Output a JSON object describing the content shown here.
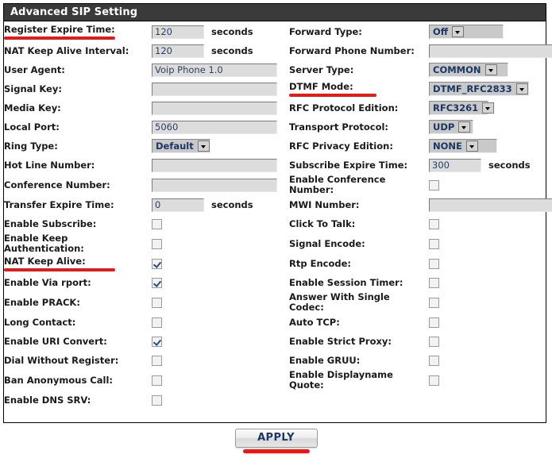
{
  "window": {
    "title": "Advanced SIP Setting"
  },
  "units": {
    "seconds": "seconds"
  },
  "rows": [
    {
      "left": {
        "label": "Register Expire Time:",
        "type": "text",
        "value": "120",
        "unit": "seconds",
        "marked": true,
        "marker_width": "w1"
      },
      "right": {
        "label": "Forward Type:",
        "type": "select",
        "value": "Off",
        "width": "w-off"
      }
    },
    {
      "left": {
        "label": "NAT Keep Alive Interval:",
        "type": "text",
        "value": "120",
        "unit": "seconds"
      },
      "right": {
        "label": "Forward Phone Number:",
        "type": "text-long",
        "value": ""
      }
    },
    {
      "left": {
        "label": "User Agent:",
        "type": "text-long",
        "value": "Voip Phone 1.0"
      },
      "right": {
        "label": "Server Type:",
        "type": "select",
        "value": "COMMON",
        "width": "w-com"
      }
    },
    {
      "left": {
        "label": "Signal Key:",
        "type": "text-long",
        "value": ""
      },
      "right": {
        "label": "DTMF Mode:",
        "type": "select",
        "value": "DTMF_RFC2833",
        "width": "w-dtmf",
        "marked": true,
        "marker_width": "w2"
      }
    },
    {
      "left": {
        "label": "Media Key:",
        "type": "text-long",
        "value": ""
      },
      "right": {
        "label": "RFC Protocol Edition:",
        "type": "select",
        "value": "RFC3261",
        "width": "w-3261"
      }
    },
    {
      "left": {
        "label": "Local Port:",
        "type": "text-long",
        "value": "5060"
      },
      "right": {
        "label": "Transport Protocol:",
        "type": "select",
        "value": "UDP",
        "width": "w-udp"
      }
    },
    {
      "left": {
        "label": "Ring Type:",
        "type": "select",
        "value": "Default",
        "width": "w-def"
      },
      "right": {
        "label": "RFC Privacy Edition:",
        "type": "select",
        "value": "NONE",
        "width": "w-none"
      }
    },
    {
      "left": {
        "label": "Hot Line Number:",
        "type": "text-long",
        "value": ""
      },
      "right": {
        "label": "Subscribe Expire Time:",
        "type": "text",
        "value": "300",
        "unit": "seconds"
      }
    },
    {
      "left": {
        "label": "Conference Number:",
        "type": "text-long",
        "value": ""
      },
      "right": {
        "label": "Enable Conference Number:",
        "type": "checkbox",
        "checked": false,
        "two_line": [
          "Enable Conference",
          "Number:"
        ]
      }
    },
    {
      "left": {
        "label": "Transfer Expire Time:",
        "type": "text",
        "value": "0",
        "unit": "seconds"
      },
      "right": {
        "label": "MWI Number:",
        "type": "text-long",
        "value": ""
      }
    },
    {
      "left": {
        "label": "Enable Subscribe:",
        "type": "checkbox",
        "checked": false
      },
      "right": {
        "label": "Click To Talk:",
        "type": "checkbox",
        "checked": false
      }
    },
    {
      "left": {
        "label": "Enable Keep Authentication:",
        "type": "checkbox",
        "checked": false,
        "two_line": [
          "Enable Keep",
          "Authentication:"
        ]
      },
      "right": {
        "label": "Signal Encode:",
        "type": "checkbox",
        "checked": false
      }
    },
    {
      "left": {
        "label": "NAT Keep Alive:",
        "type": "checkbox",
        "checked": true,
        "marked": true,
        "marker_width": "w1"
      },
      "right": {
        "label": "Rtp Encode:",
        "type": "checkbox",
        "checked": false
      }
    },
    {
      "left": {
        "label": "Enable Via rport:",
        "type": "checkbox",
        "checked": true
      },
      "right": {
        "label": "Enable Session Timer:",
        "type": "checkbox",
        "checked": false
      }
    },
    {
      "left": {
        "label": "Enable PRACK:",
        "type": "checkbox",
        "checked": false
      },
      "right": {
        "label": "Answer With Single Codec:",
        "type": "checkbox",
        "checked": false,
        "two_line": [
          "Answer With Single",
          "Codec:"
        ]
      }
    },
    {
      "left": {
        "label": "Long Contact:",
        "type": "checkbox",
        "checked": false
      },
      "right": {
        "label": "Auto TCP:",
        "type": "checkbox",
        "checked": false
      }
    },
    {
      "left": {
        "label": "Enable URI Convert:",
        "type": "checkbox",
        "checked": true
      },
      "right": {
        "label": "Enable Strict Proxy:",
        "type": "checkbox",
        "checked": false
      }
    },
    {
      "left": {
        "label": "Dial Without Register:",
        "type": "checkbox",
        "checked": false
      },
      "right": {
        "label": "Enable GRUU:",
        "type": "checkbox",
        "checked": false
      }
    },
    {
      "left": {
        "label": "Ban Anonymous Call:",
        "type": "checkbox",
        "checked": false
      },
      "right": {
        "label": "Enable Displayname Quote:",
        "type": "checkbox",
        "checked": false,
        "two_line": [
          "Enable Displayname",
          "Quote:"
        ]
      }
    },
    {
      "left": {
        "label": "Enable DNS SRV:",
        "type": "checkbox",
        "checked": false
      },
      "right": {
        "label": "",
        "type": "empty"
      }
    }
  ],
  "apply": {
    "label": "APPLY"
  },
  "colors": {
    "titlebar_bg": "#3a3a3a",
    "marker_red": "#e01b1b",
    "field_bg": "#dcdcdc",
    "select_text": "#1b3664"
  }
}
